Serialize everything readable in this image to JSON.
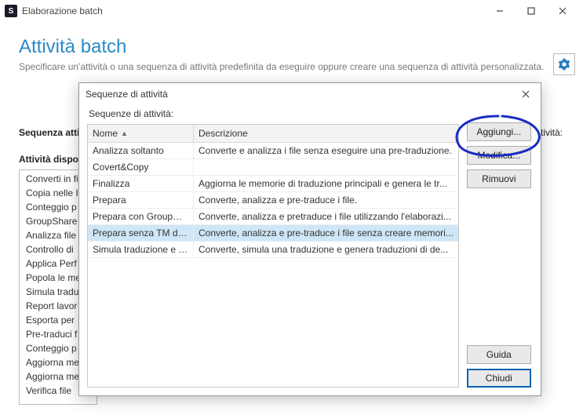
{
  "window": {
    "title": "Elaborazione batch"
  },
  "page": {
    "heading": "Attività batch",
    "sub": "Specificare un'attività o una sequenza di attività predefinita da eseguire oppure creare una sequenza di attività personalizzata."
  },
  "main_labels": {
    "seq": "Sequenza atti",
    "avail": "Attività dispo",
    "right_truncated": "attività:"
  },
  "available_list": [
    "Converti in fi",
    "Copia nelle I",
    "Conteggio p",
    "GroupShare",
    "Analizza file",
    "Controllo di",
    "Applica Perf",
    "Popola le me",
    "Simula tradu",
    "Report lavor",
    "Esporta per",
    "Pre-traduci f",
    "Conteggio p",
    "Aggiorna me",
    "Aggiorna me",
    "Verifica file"
  ],
  "modal": {
    "title": "Sequenze di attività",
    "caption": "Sequenze di attività:",
    "columns": {
      "name": "Nome",
      "desc": "Descrizione"
    },
    "rows": [
      {
        "name": "Analizza soltanto",
        "desc": "Converte e analizza i file senza eseguire una pre-traduzione."
      },
      {
        "name": "Covert&Copy",
        "desc": ""
      },
      {
        "name": "Finalizza",
        "desc": "Aggiorna le memorie di traduzione principali e genera le tr..."
      },
      {
        "name": "Prepara",
        "desc": "Converte, analizza e pre-traduce i file."
      },
      {
        "name": "Prepara con GroupShare",
        "desc": "Converte, analizza e pretraduce i file utilizzando l'elaborazi..."
      },
      {
        "name": "Prepara senza TM di proge...",
        "desc": "Converte, analizza e pre-traduce i file senza creare memori..."
      },
      {
        "name": "Simula traduzione e crea fi...",
        "desc": "Converte, simula una traduzione e genera traduzioni di de..."
      }
    ],
    "selected_index": 5,
    "buttons": {
      "add": "Aggiungi...",
      "edit": "Modifica...",
      "remove": "Rimuovi",
      "help": "Guida",
      "close": "Chiudi"
    }
  }
}
